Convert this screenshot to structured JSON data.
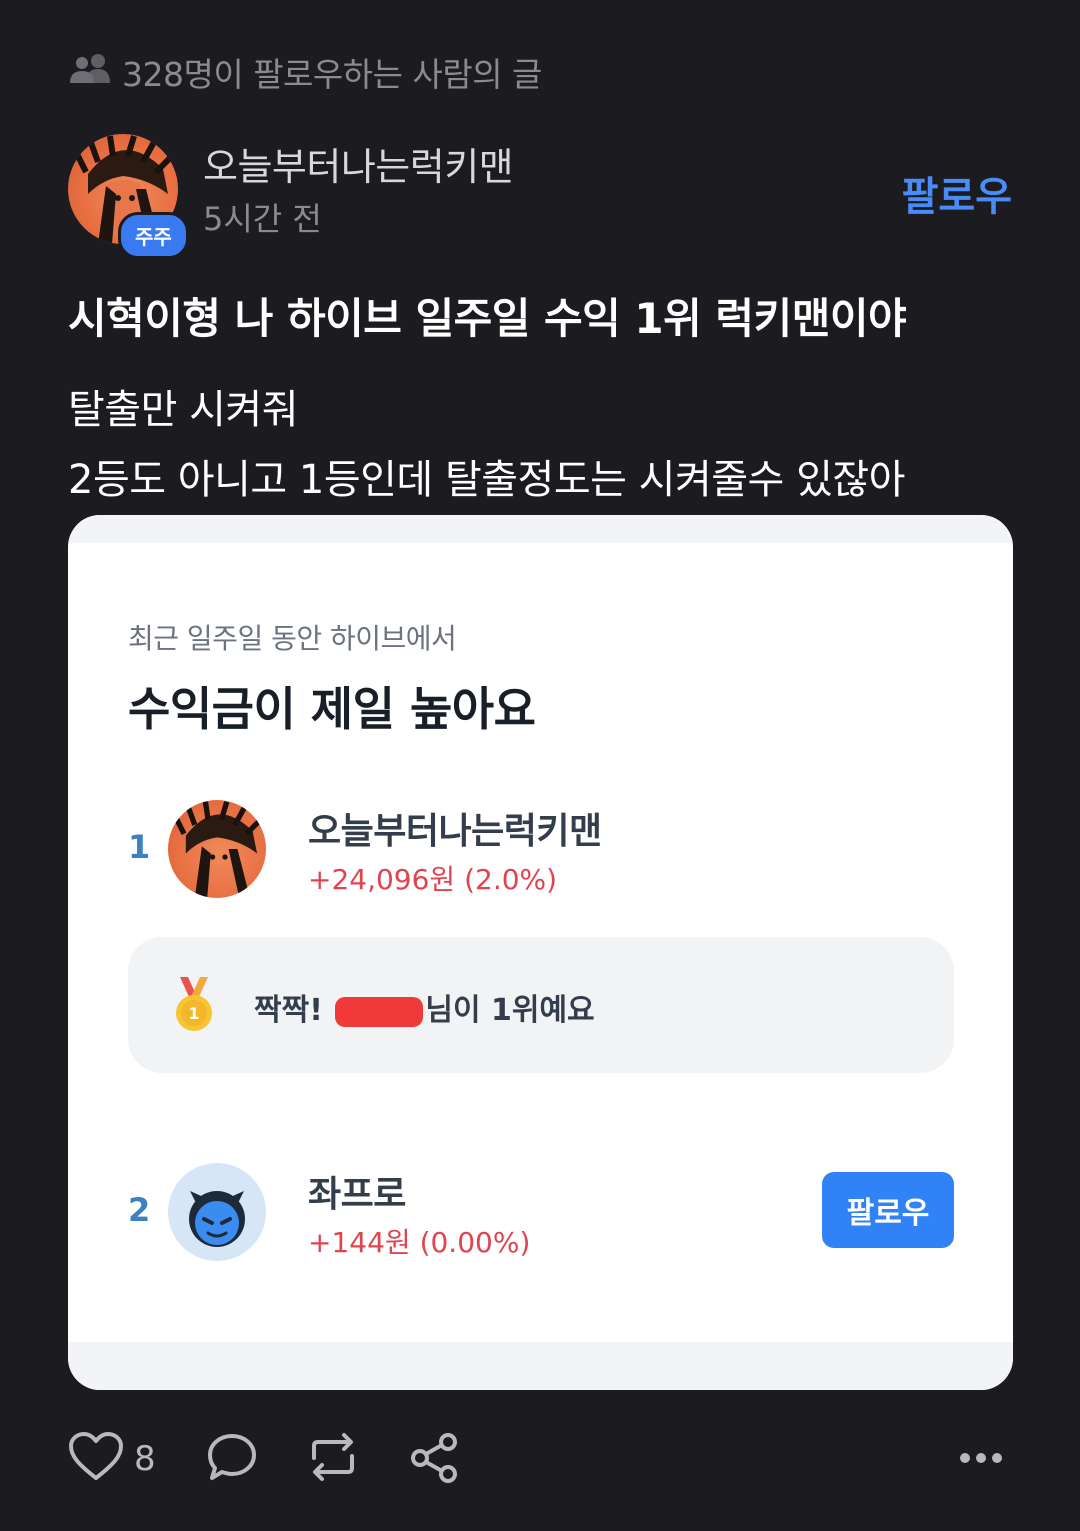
{
  "header": {
    "followers_text": "328명이 팔로우하는 사람의 글"
  },
  "author": {
    "name": "오늘부터나는럭키맨",
    "badge": "주주",
    "time": "5시간 전",
    "follow_label": "팔로우"
  },
  "post": {
    "title": "시혁이형 나 하이브 일주일 수익 1위 럭키맨이야",
    "body_line1": "탈출만 시켜줘",
    "body_line2": "2등도 아니고 1등인데 탈출정도는 시켜줄수 있잖아"
  },
  "card": {
    "subtitle": "최근 일주일 동안 하이브에서",
    "title": "수익금이 제일 높아요",
    "ranks": [
      {
        "rank": "1",
        "name": "오늘부터나는럭키맨",
        "profit": "+24,096원 (2.0%)"
      },
      {
        "rank": "2",
        "name": "좌프로",
        "profit": "+144원 (0.00%)",
        "follow_label": "팔로우"
      }
    ],
    "congrats_prefix": "짝짝!",
    "congrats_suffix": "님이 1위예요",
    "medal_number": "1"
  },
  "actions": {
    "like_count": "8"
  },
  "colors": {
    "background": "#1b1b20",
    "accent": "#4a8cf7",
    "profit": "#e0454f",
    "button": "#3182f6"
  },
  "icons": [
    "people-icon",
    "heart-icon",
    "comment-icon",
    "repost-icon",
    "share-icon",
    "more-icon",
    "medal-icon"
  ]
}
